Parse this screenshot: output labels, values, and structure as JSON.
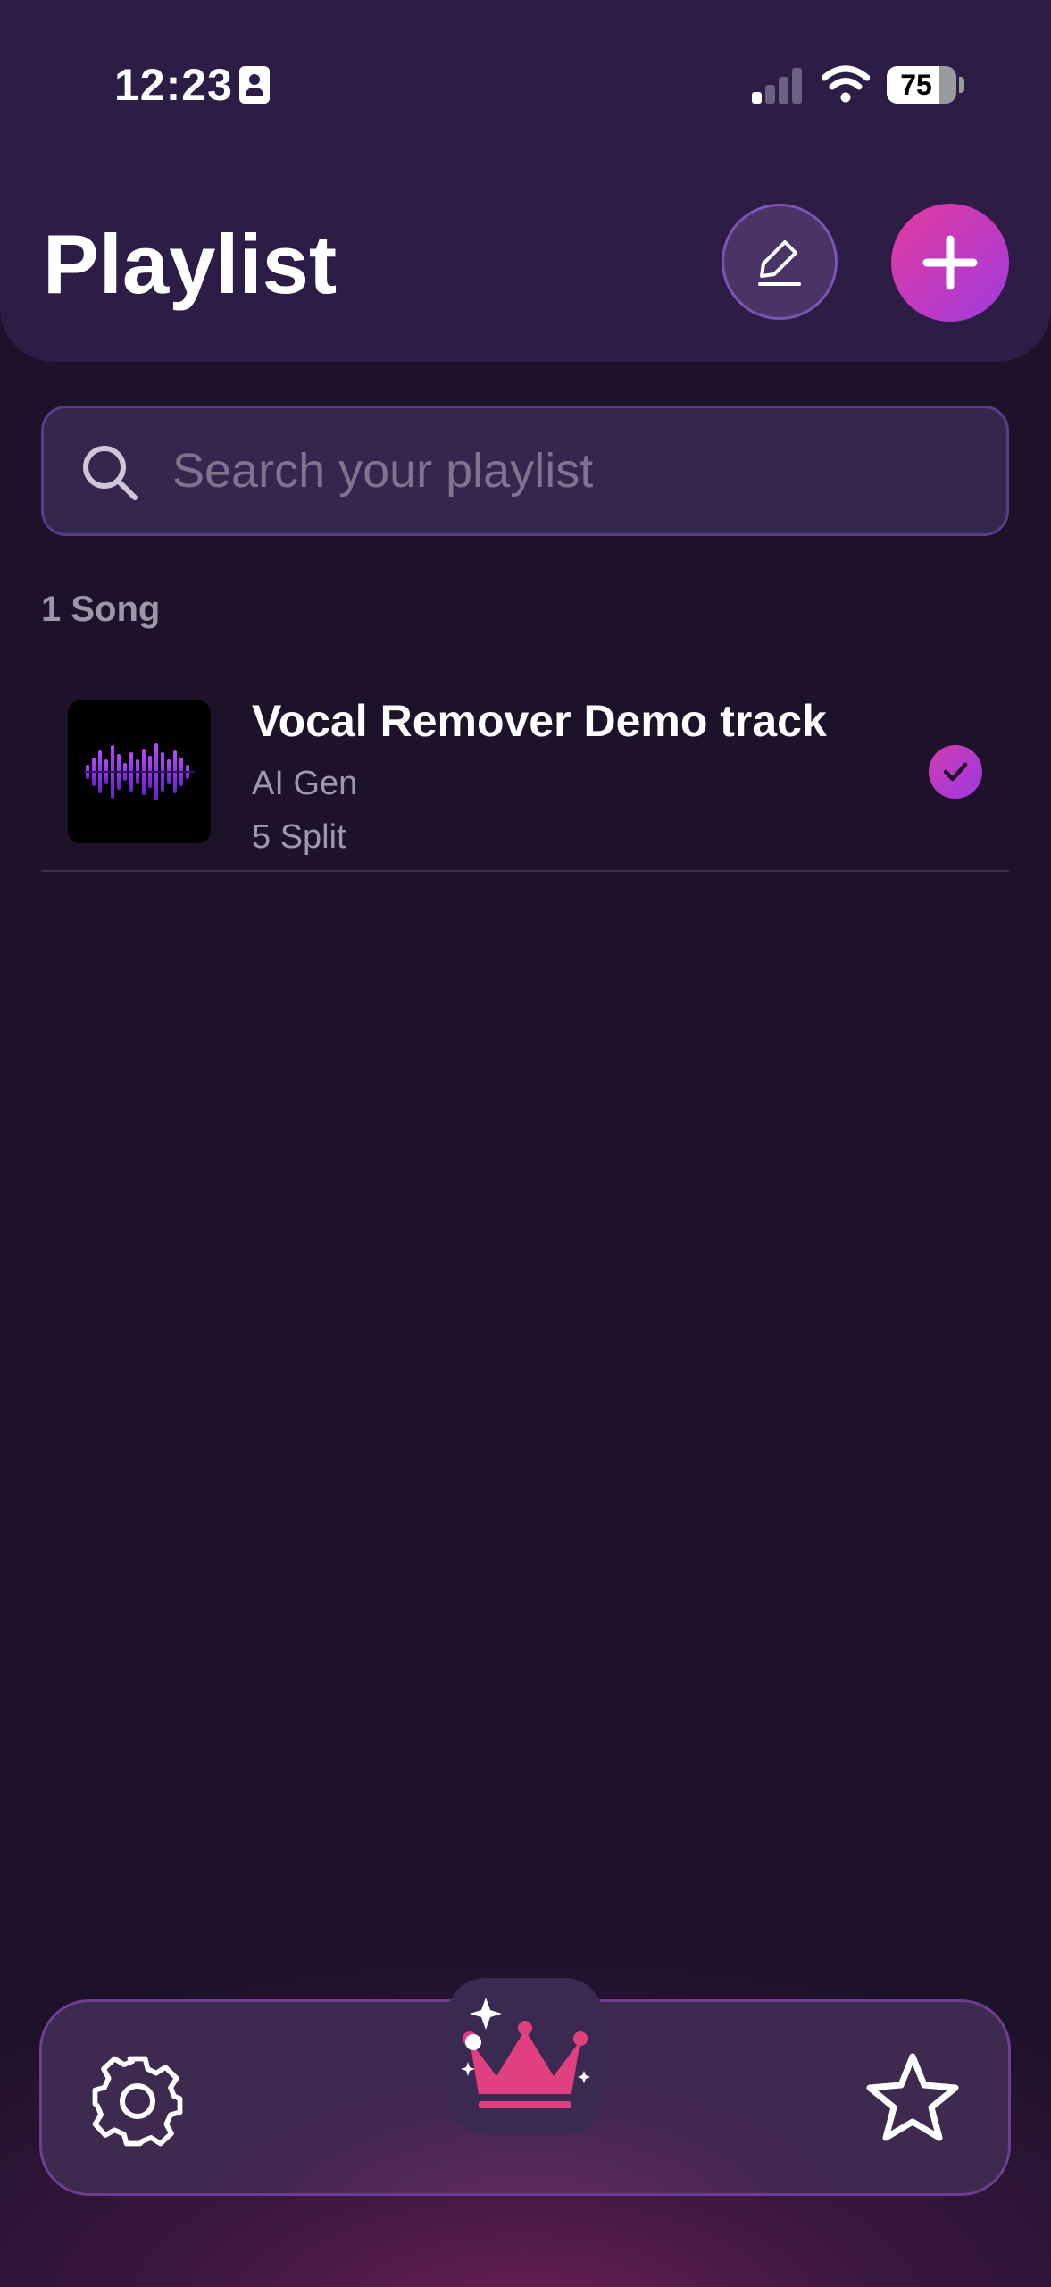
{
  "status_bar": {
    "time": "12:23",
    "battery": "75",
    "battery_level": 0.75
  },
  "header": {
    "title": "Playlist"
  },
  "search": {
    "placeholder": "Search your playlist",
    "value": ""
  },
  "list": {
    "count_label": "1 Song",
    "items": [
      {
        "title": "Vocal Remover Demo track",
        "artist": "AI Gen",
        "splits": "5 Split",
        "selected": true
      }
    ]
  },
  "tabbar": {
    "items": [
      "settings",
      "premium",
      "favorites"
    ]
  },
  "colors": {
    "background": "#1e112a",
    "header": "#2d1d46",
    "accent_pink": "#e43b9c",
    "accent_purple": "#a03ae0"
  }
}
